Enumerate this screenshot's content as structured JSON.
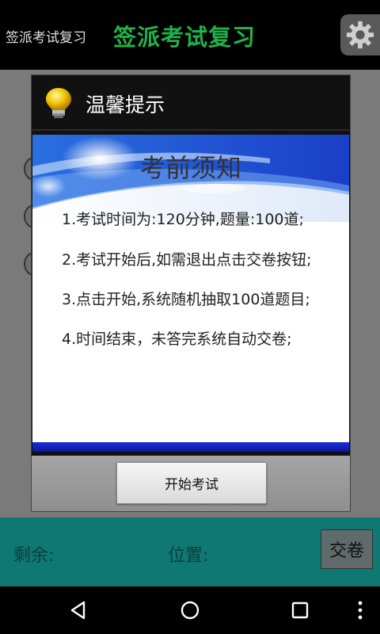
{
  "header": {
    "small_title": "签派考试复习",
    "big_title": "签派考试复习",
    "settings_icon": "gear-icon"
  },
  "background": {
    "remaining_label": "剩余:",
    "position_label": "位置:",
    "submit_label": "交卷",
    "bar_color": "#0f7873"
  },
  "dialog": {
    "title": "温馨提示",
    "icon": "lightbulb-icon",
    "heading": "考前须知",
    "lines": [
      "1.考试时间为:120分钟,题量:100道;",
      "2.考试开始后,如需退出点击交卷按钮;",
      "3.点击开始,系统随机抽取100道题目;",
      "4.时间结束，未答完系统自动交卷;"
    ],
    "start_button": "开始考试"
  },
  "nav": {
    "back_icon": "back-triangle-icon",
    "home_icon": "home-circle-icon",
    "recents_icon": "recents-square-icon",
    "menu_icon": "overflow-menu-icon"
  }
}
